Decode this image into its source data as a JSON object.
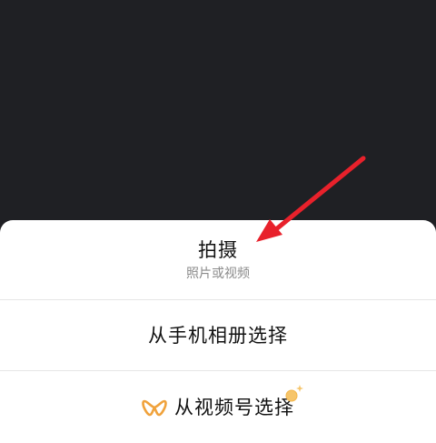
{
  "sheet": {
    "options": [
      {
        "label": "拍摄",
        "sublabel": "照片或视频"
      },
      {
        "label": "从手机相册选择"
      },
      {
        "label": "从视频号选择",
        "icon": "channels-icon",
        "badge": "sparkle-badge-icon"
      }
    ]
  },
  "annotation": {
    "arrow_icon": "red-arrow-icon",
    "arrow_color": "#e8212b"
  },
  "colors": {
    "backdrop": "#1f2024",
    "sheet": "#ffffff",
    "divider": "#e5e5e5",
    "primary_text": "#111111",
    "secondary_text": "#8a8a8a",
    "channels_icon": "#f0a23b"
  }
}
